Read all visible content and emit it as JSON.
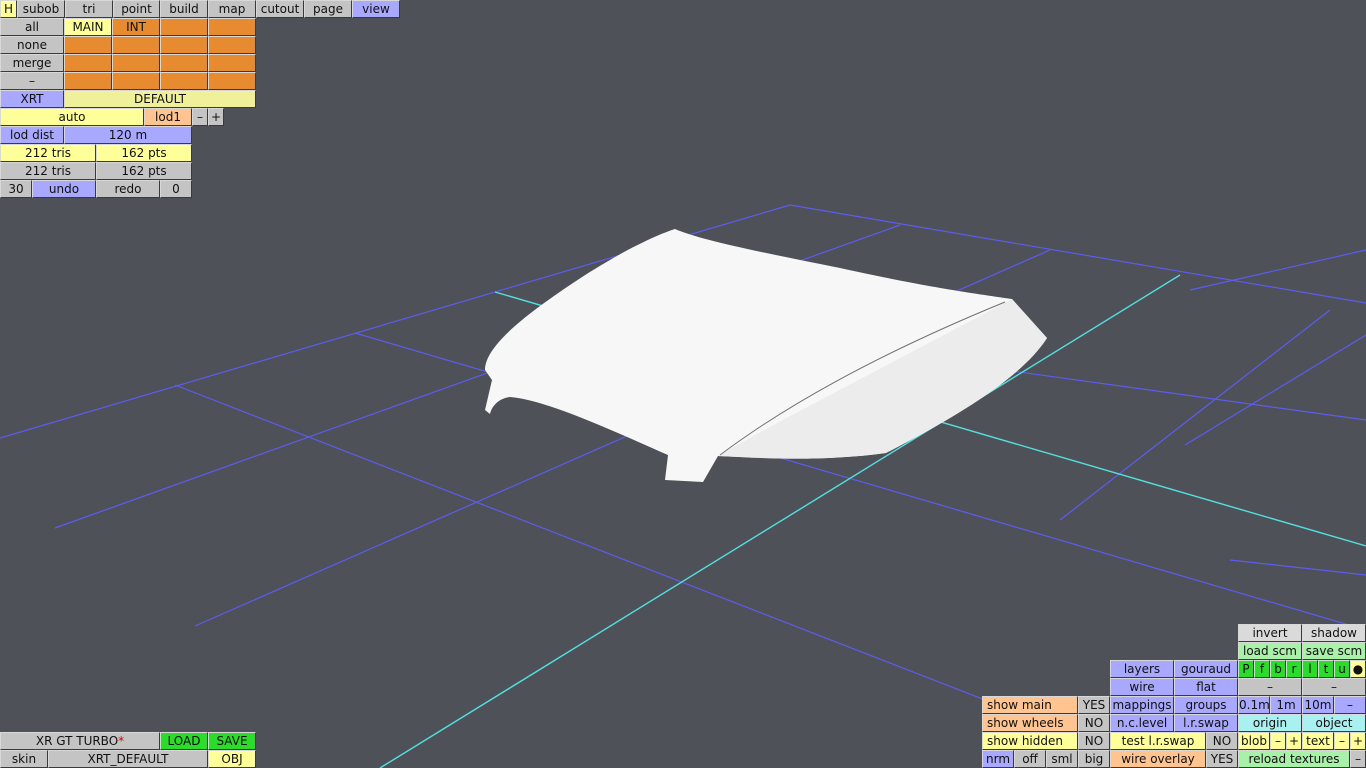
{
  "top_menu": [
    "H",
    "subob",
    "tri",
    "point",
    "build",
    "map",
    "cutout",
    "page",
    "view"
  ],
  "layer_panel": {
    "all": "all",
    "none": "none",
    "merge": "merge",
    "dash": "–",
    "main": "MAIN",
    "int": "INT",
    "xrt": "XRT",
    "default": "DEFAULT",
    "auto": "auto",
    "lod1": "lod1",
    "minus": "–",
    "plus": "+",
    "lod_dist_label": "lod dist",
    "lod_dist_value": "120 m",
    "tris1": "212 tris",
    "pts1": "162 pts",
    "tris2": "212 tris",
    "pts2": "162 pts",
    "undo_count": "30",
    "undo": "undo",
    "redo": "redo",
    "redo_count": "0"
  },
  "bottom_left": {
    "car_name": "XR GT TURBO",
    "modified_marker": "*",
    "load": "LOAD",
    "save": "SAVE",
    "skin": "skin",
    "skin_name": "XRT_DEFAULT",
    "obj": "OBJ"
  },
  "bottom_right": {
    "invert": "invert",
    "shadow": "shadow",
    "load_scm": "load scm",
    "save_scm": "save scm",
    "view_keys": [
      "P",
      "f",
      "b",
      "r",
      "l",
      "t",
      "u",
      "●"
    ],
    "layers": "layers",
    "gouraud": "gouraud",
    "wire": "wire",
    "flat": "flat",
    "dash": "–",
    "show_main": "show main",
    "show_main_val": "YES",
    "mappings": "mappings",
    "groups": "groups",
    "grid_01": "0.1m",
    "grid_1": "1m",
    "grid_10": "10m",
    "show_wheels": "show wheels",
    "show_wheels_val": "NO",
    "nc_level": "n.c.level",
    "lr_swap": "l.r.swap",
    "origin": "origin",
    "object": "object",
    "show_hidden": "show hidden",
    "show_hidden_val": "NO",
    "test_lr_swap": "test l.r.swap",
    "test_lr_swap_val": "NO",
    "blob": "blob",
    "text": "text",
    "minus": "–",
    "plus": "+",
    "nrm": "nrm",
    "off": "off",
    "sml": "sml",
    "big": "big",
    "wire_overlay": "wire overlay",
    "wire_overlay_val": "YES",
    "reload_textures": "reload textures"
  }
}
